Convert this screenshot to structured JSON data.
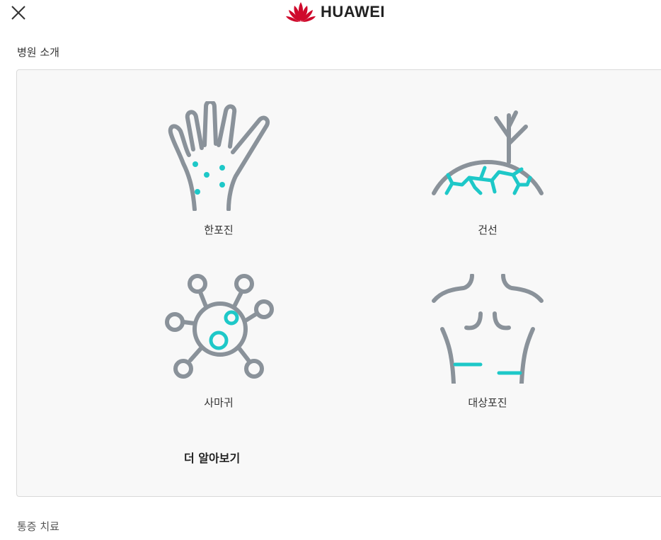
{
  "header": {
    "close_icon": "close-icon",
    "brand": {
      "logo_icon": "huawei-flower-logo-icon",
      "name": "HUAWEI",
      "logo_color": "#cf0a2c"
    }
  },
  "section1": {
    "title": "병원 소개",
    "items": [
      {
        "label": "한포진",
        "icon": "hand-rash-icon"
      },
      {
        "label": "건선",
        "icon": "skin-crack-icon"
      },
      {
        "label": "사마귀",
        "icon": "virus-cell-icon"
      },
      {
        "label": "대상포진",
        "icon": "torso-icon"
      }
    ],
    "more_label": "더 알아보기"
  },
  "section2": {
    "title": "통증 치료"
  },
  "colors": {
    "icon_gray": "#8a929a",
    "icon_accent": "#1ec8c8",
    "card_bg": "#f8f8f8"
  }
}
